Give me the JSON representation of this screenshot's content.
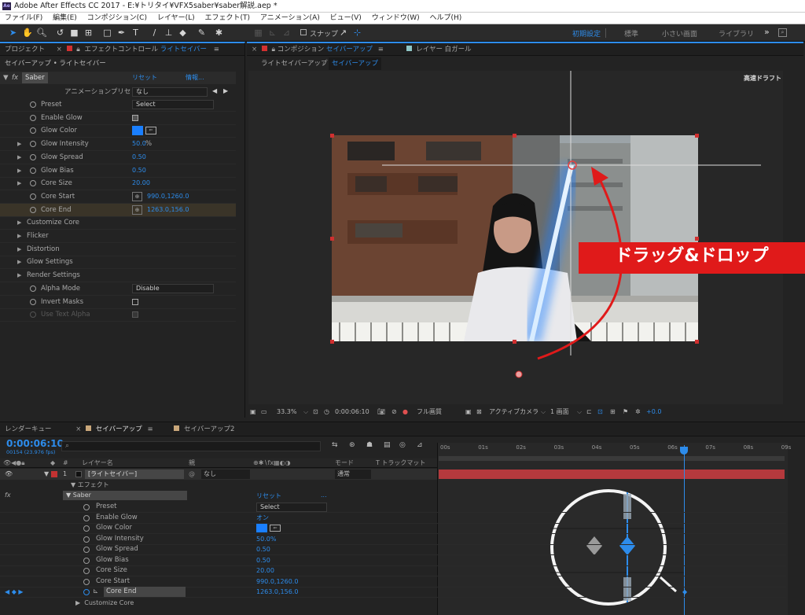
{
  "titlebar": {
    "app_icon": "Ae",
    "title": "Adobe After Effects CC 2017 - E:¥トリタイ¥VFX5saber¥saber解説.aep *"
  },
  "menu": [
    "ファイル(F)",
    "編集(E)",
    "コンポジション(C)",
    "レイヤー(L)",
    "エフェクト(T)",
    "アニメーション(A)",
    "ビュー(V)",
    "ウィンドウ(W)",
    "ヘルプ(H)"
  ],
  "toolbar": {
    "snap_label": "スナップ",
    "workspaces": [
      "初期設定",
      "標準",
      "小さい画面",
      "ライブラリ"
    ],
    "more": "»"
  },
  "left_panel": {
    "tab_project": "プロジェクト",
    "tab_effect": "エフェクトコントロール",
    "tab_effect_layer": "ライトセイバー",
    "menu_icon": "≡",
    "breadcrumb": "セイバーアップ • ライトセイバー",
    "fx_label": "fx",
    "effect_name": "Saber",
    "reset": "リセット",
    "about": "情報...",
    "preset_label": "アニメーションプリセット：",
    "preset_value": "なし",
    "props": [
      {
        "name": "Preset",
        "value": "Select",
        "kind": "dropdown"
      },
      {
        "name": "Enable Glow",
        "value": "",
        "kind": "check"
      },
      {
        "name": "Glow Color",
        "value": "",
        "kind": "color"
      },
      {
        "name": "Glow Intensity",
        "value": "50.0",
        "unit": "%",
        "kind": "num",
        "expand": true
      },
      {
        "name": "Glow Spread",
        "value": "0.50",
        "kind": "num",
        "expand": true
      },
      {
        "name": "Glow Bias",
        "value": "0.50",
        "kind": "num",
        "expand": true
      },
      {
        "name": "Core Size",
        "value": "20.00",
        "kind": "num",
        "expand": true
      },
      {
        "name": "Core Start",
        "value": "990.0,1260.0",
        "kind": "point"
      },
      {
        "name": "Core End",
        "value": "1263.0,156.0",
        "kind": "point",
        "highlight": true
      }
    ],
    "groups": [
      "Customize Core",
      "Flicker",
      "Distortion",
      "Glow Settings",
      "Render Settings"
    ],
    "alpha_props": [
      {
        "name": "Alpha Mode",
        "value": "Disable",
        "kind": "dropdown"
      },
      {
        "name": "Invert Masks",
        "value": "",
        "kind": "check"
      },
      {
        "name": "Use Text Alpha",
        "value": "",
        "kind": "check",
        "disabled": true
      }
    ]
  },
  "comp_panel": {
    "tab": "コンポジション",
    "tab_name": "セイバーアップ",
    "layer_tab": "レイヤー 白ガール",
    "menu_icon": "≡",
    "crumbs": [
      "ライトセイバーアップ",
      "セイバーアップ"
    ],
    "draft": "高速ドラフト",
    "annotation": "ドラッグ&ドロップ",
    "bottom": {
      "zoom": "33.3%",
      "time": "0:00:06:10",
      "quality": "フル画質",
      "camera": "アクティブカメラ",
      "views": "1 画面",
      "exposure": "+0.0"
    }
  },
  "timeline": {
    "tabs": [
      "レンダーキュー",
      "セイバーアップ",
      "セイバーアップ2"
    ],
    "timecode": "0:00:06:10",
    "fps": "00154 (23.976 fps)",
    "col_layer": "レイヤー名",
    "col_parent": "親",
    "col_mode": "モード",
    "col_track": "T トラックマット",
    "layer": {
      "num": "1",
      "name": "[ライトセイバー]",
      "parent": "なし",
      "mode": "通常"
    },
    "effects_label": "エフェクト",
    "effect": "Saber",
    "reset": "リセット",
    "dots": "...",
    "props": [
      {
        "name": "Preset",
        "value": "Select"
      },
      {
        "name": "Enable Glow",
        "value": "オン"
      },
      {
        "name": "Glow Color",
        "value": ""
      },
      {
        "name": "Glow Intensity",
        "value": "50.0%"
      },
      {
        "name": "Glow Spread",
        "value": "0.50"
      },
      {
        "name": "Glow Bias",
        "value": "0.50"
      },
      {
        "name": "Core Size",
        "value": "20.00"
      },
      {
        "name": "Core Start",
        "value": "990.0,1260.0"
      },
      {
        "name": "Core End",
        "value": "1263.0,156.0"
      }
    ],
    "customize": "Customize Core",
    "ruler": [
      "00s",
      "01s",
      "02s",
      "03s",
      "04s",
      "05s",
      "06s",
      "07s",
      "08s",
      "09s"
    ]
  },
  "colors": {
    "accent": "#2d8ceb",
    "glow": "#1a7fff",
    "badge": "#e01a1a",
    "layer_bar": "#b5393d"
  }
}
